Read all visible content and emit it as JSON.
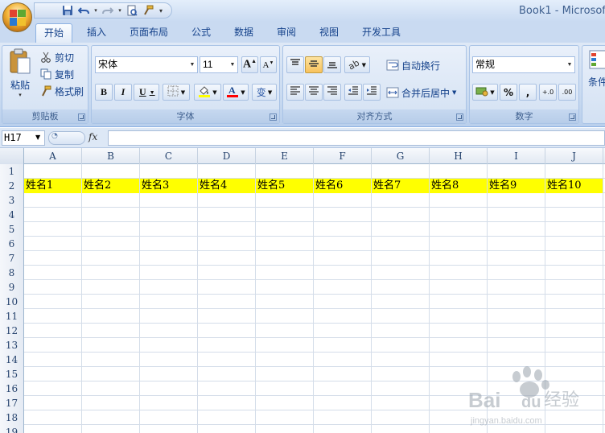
{
  "window": {
    "title": "Book1 - Microsof"
  },
  "quick_access": {
    "icons": [
      "save-icon",
      "undo-icon",
      "redo-icon",
      "print-preview-icon",
      "format-painter-icon",
      "customize-icon"
    ]
  },
  "tabs": [
    {
      "label": "开始",
      "active": true
    },
    {
      "label": "插入"
    },
    {
      "label": "页面布局"
    },
    {
      "label": "公式"
    },
    {
      "label": "数据"
    },
    {
      "label": "审阅"
    },
    {
      "label": "视图"
    },
    {
      "label": "开发工具"
    }
  ],
  "clipboard": {
    "paste": "粘贴",
    "cut": "剪切",
    "copy": "复制",
    "format_painter": "格式刷",
    "label": "剪贴板"
  },
  "font": {
    "family": "宋体",
    "size": "11",
    "bold": "B",
    "italic": "I",
    "underline": "U",
    "label": "字体",
    "fill_color": "#ffff00",
    "font_color": "#ff0000"
  },
  "alignment": {
    "wrap_text": "自动换行",
    "merge_center": "合并后居中",
    "label": "对齐方式"
  },
  "number": {
    "format": "常规",
    "percent": "%",
    "comma": ",",
    "increase_decimal": "+.0",
    "decrease_decimal": ".00",
    "label": "数字"
  },
  "styles": {
    "conditional": "条件"
  },
  "formula_bar": {
    "name_box": "H17",
    "fx": "fx",
    "value": ""
  },
  "sheet": {
    "columns": [
      "A",
      "B",
      "C",
      "D",
      "E",
      "F",
      "G",
      "H",
      "I",
      "J"
    ],
    "rows": [
      {
        "num": "1",
        "cells": []
      },
      {
        "num": "2",
        "highlight": true,
        "cells": [
          "姓名1",
          "姓名2",
          "姓名3",
          "姓名4",
          "姓名5",
          "姓名6",
          "姓名7",
          "姓名8",
          "姓名9",
          "姓名10"
        ]
      },
      {
        "num": "3",
        "cells": []
      },
      {
        "num": "4",
        "cells": []
      },
      {
        "num": "5",
        "cells": []
      },
      {
        "num": "6",
        "cells": []
      },
      {
        "num": "7",
        "cells": []
      },
      {
        "num": "8",
        "cells": []
      },
      {
        "num": "9",
        "cells": []
      },
      {
        "num": "10",
        "cells": []
      },
      {
        "num": "11",
        "cells": []
      },
      {
        "num": "12",
        "cells": []
      },
      {
        "num": "13",
        "cells": []
      },
      {
        "num": "14",
        "cells": []
      },
      {
        "num": "15",
        "cells": []
      },
      {
        "num": "16",
        "cells": []
      },
      {
        "num": "17",
        "cells": []
      },
      {
        "num": "18",
        "cells": []
      },
      {
        "num": "19",
        "cells": []
      }
    ],
    "highlight_color": "#ffff00"
  },
  "watermark": {
    "brand": "Bai",
    "brand2": "du",
    "text": "经验",
    "url": "jingyan.baidu.com"
  }
}
